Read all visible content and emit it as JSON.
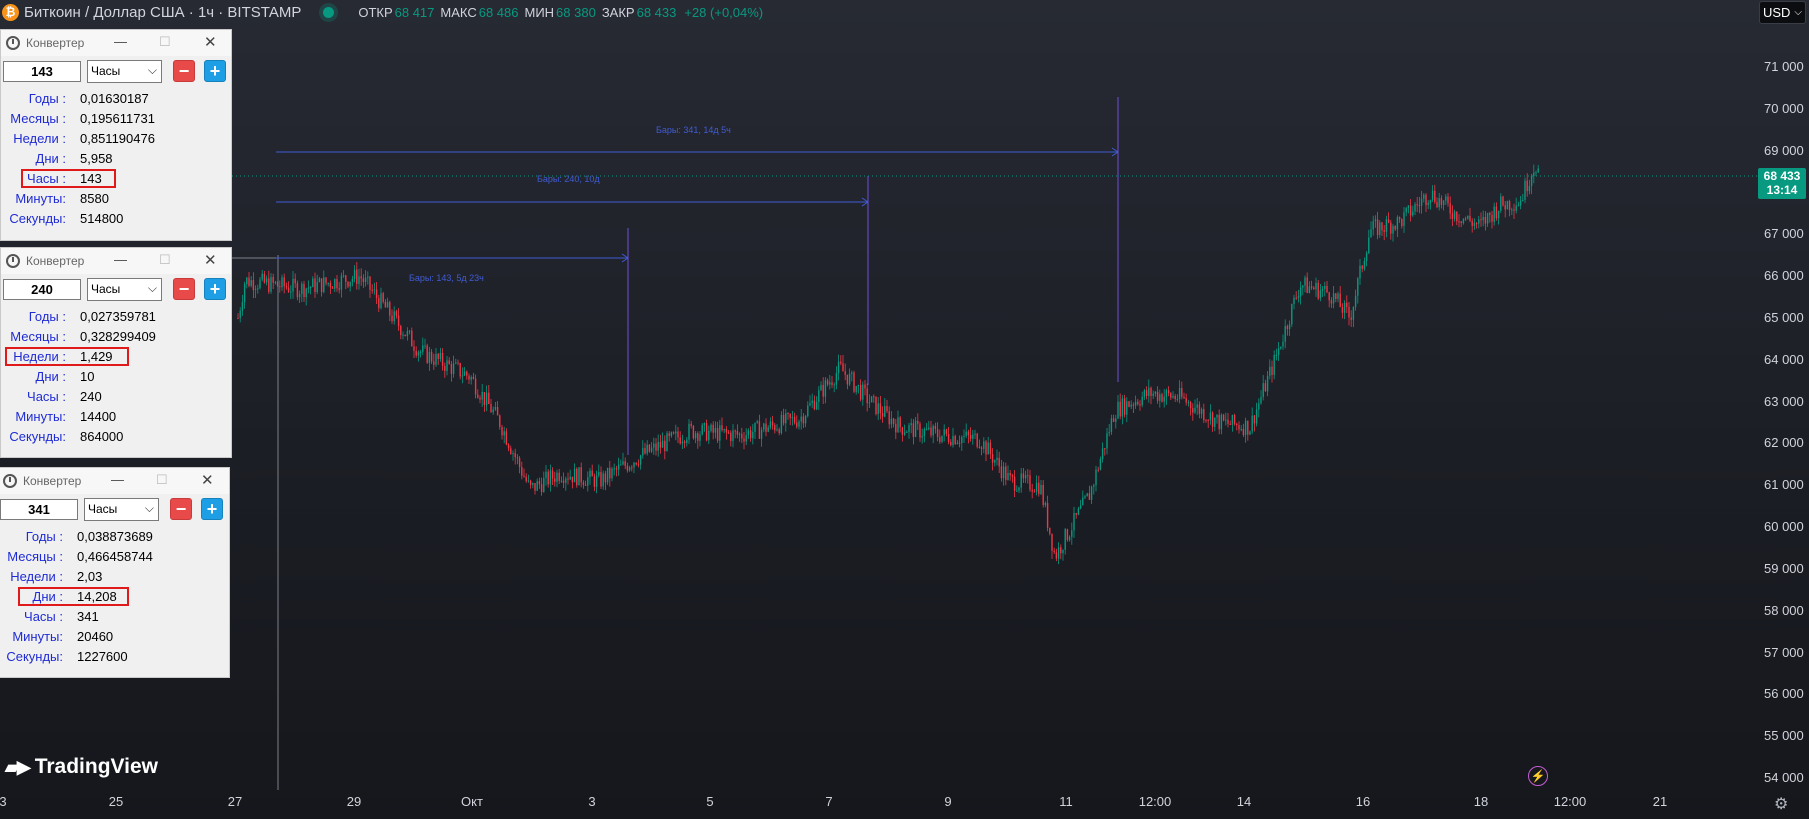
{
  "header": {
    "title": "Биткоин / Доллар США · 1ч · BITSTAMP",
    "open_label": "ОТКР",
    "open_value": "68 417",
    "high_label": "МАКС",
    "high_value": "68 486",
    "low_label": "МИН",
    "low_value": "68 380",
    "close_label": "ЗАКР",
    "close_value": "68 433",
    "change": "+28 (+0,04%)"
  },
  "currency": {
    "label": "USD"
  },
  "price_axis": [
    "71 000",
    "70 000",
    "69 000",
    "68 000",
    "67 000",
    "66 000",
    "65 000",
    "64 000",
    "63 000",
    "62 000",
    "61 000",
    "60 000",
    "59 000",
    "58 000",
    "57 000",
    "56 000",
    "55 000",
    "54 000"
  ],
  "time_axis": [
    "3",
    "25",
    "27",
    "29",
    "Окт",
    "3",
    "5",
    "7",
    "9",
    "11",
    "12:00",
    "14",
    "16",
    "18",
    "12:00",
    "21"
  ],
  "current_price": {
    "price": "68 433",
    "countdown": "13:14"
  },
  "measures": [
    {
      "text": "Бары: 143, 5д 23ч"
    },
    {
      "text": "Бары: 240, 10д"
    },
    {
      "text": "Бары: 341, 14д 5ч"
    }
  ],
  "brand": {
    "name": "TradingView"
  },
  "chart_data": {
    "type": "candlestick",
    "series": [
      {
        "x": [
          "27 сен",
          "29 сен",
          "Окт",
          "3 окт",
          "5 окт",
          "7 окт",
          "9 окт",
          "11 окт",
          "14 окт",
          "16 окт",
          "18 окт"
        ],
        "close": [
          65900,
          65700,
          64500,
          60900,
          62200,
          63600,
          62100,
          59200,
          62900,
          67600,
          68433
        ]
      }
    ],
    "ylim": [
      54000,
      71000
    ],
    "current_price": 68433
  },
  "converters": [
    {
      "title": "Конвертер",
      "value": "143",
      "unit": "Часы",
      "rows": [
        {
          "label": "Годы :",
          "value": "0,01630187"
        },
        {
          "label": "Месяцы :",
          "value": "0,195611731"
        },
        {
          "label": "Недели :",
          "value": "0,851190476"
        },
        {
          "label": "Дни :",
          "value": "5,958"
        },
        {
          "label": "Часы :",
          "value": "143"
        },
        {
          "label": "Минуты:",
          "value": "8580"
        },
        {
          "label": "Секунды:",
          "value": "514800"
        }
      ]
    },
    {
      "title": "Конвертер",
      "value": "240",
      "unit": "Часы",
      "rows": [
        {
          "label": "Годы :",
          "value": "0,027359781"
        },
        {
          "label": "Месяцы :",
          "value": "0,328299409"
        },
        {
          "label": "Недели :",
          "value": "1,429"
        },
        {
          "label": "Дни :",
          "value": "10"
        },
        {
          "label": "Часы :",
          "value": "240"
        },
        {
          "label": "Минуты:",
          "value": "14400"
        },
        {
          "label": "Секунды:",
          "value": "864000"
        }
      ]
    },
    {
      "title": "Конвертер",
      "value": "341",
      "unit": "Часы",
      "rows": [
        {
          "label": "Годы :",
          "value": "0,038873689"
        },
        {
          "label": "Месяцы :",
          "value": "0,466458744"
        },
        {
          "label": "Недели :",
          "value": "2,03"
        },
        {
          "label": "Дни :",
          "value": "14,208"
        },
        {
          "label": "Часы :",
          "value": "341"
        },
        {
          "label": "Минуты:",
          "value": "20460"
        },
        {
          "label": "Секунды:",
          "value": "1227600"
        }
      ]
    }
  ]
}
